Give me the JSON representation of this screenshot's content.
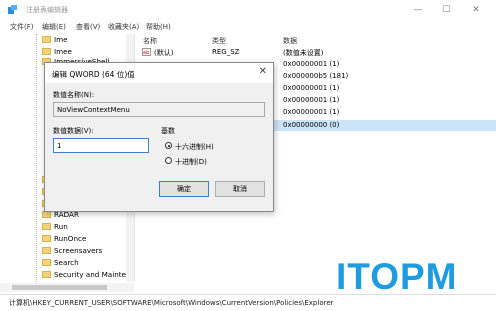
{
  "window": {
    "title": "注册表编辑器",
    "minimize": "—",
    "maximize": "☐",
    "close": "✕"
  },
  "menu": [
    "文件(F)",
    "编辑(E)",
    "查看(V)",
    "收藏夹(A)",
    "帮助(H)"
  ],
  "tree": {
    "top_items": [
      "Ime",
      "Imee",
      "ImmersiveShell"
    ],
    "bottom_items": [
      "RADAR",
      "Run",
      "RunOnce",
      "Screensavers",
      "Search",
      "Security and Mainten"
    ]
  },
  "list": {
    "headers": {
      "name": "名称",
      "type": "类型",
      "data": "数据"
    },
    "rows": [
      {
        "name": "(默认)",
        "type": "REG_SZ",
        "data": "(数值未设置)"
      },
      {
        "name": "",
        "type": "",
        "data": "0x00000001 (1)"
      },
      {
        "name": "",
        "type": "",
        "data": "0x000000b5 (181)"
      },
      {
        "name": "",
        "type": "",
        "data": "0x00000001 (1)"
      },
      {
        "name": "",
        "type": "",
        "data": "0x00000001 (1)"
      },
      {
        "name": "",
        "type": "",
        "data": "0x00000001 (1)"
      },
      {
        "name": "",
        "type": "",
        "data": "0x00000000 (0)"
      }
    ],
    "selected_index": 6
  },
  "dialog": {
    "title": "编辑 QWORD (64 位)值",
    "name_label": "数值名称(N):",
    "name_value": "NoViewContextMenu",
    "data_label": "数值数据(V):",
    "data_value": "1",
    "base_label": "基数",
    "hex_label": "十六进制(H)",
    "dec_label": "十进制(D)",
    "ok": "确定",
    "cancel": "取消"
  },
  "status_path": "计算机\\HKEY_CURRENT_USER\\SOFTWARE\\Microsoft\\Windows\\CurrentVersion\\Policies\\Explorer",
  "watermark": "ITOPM"
}
